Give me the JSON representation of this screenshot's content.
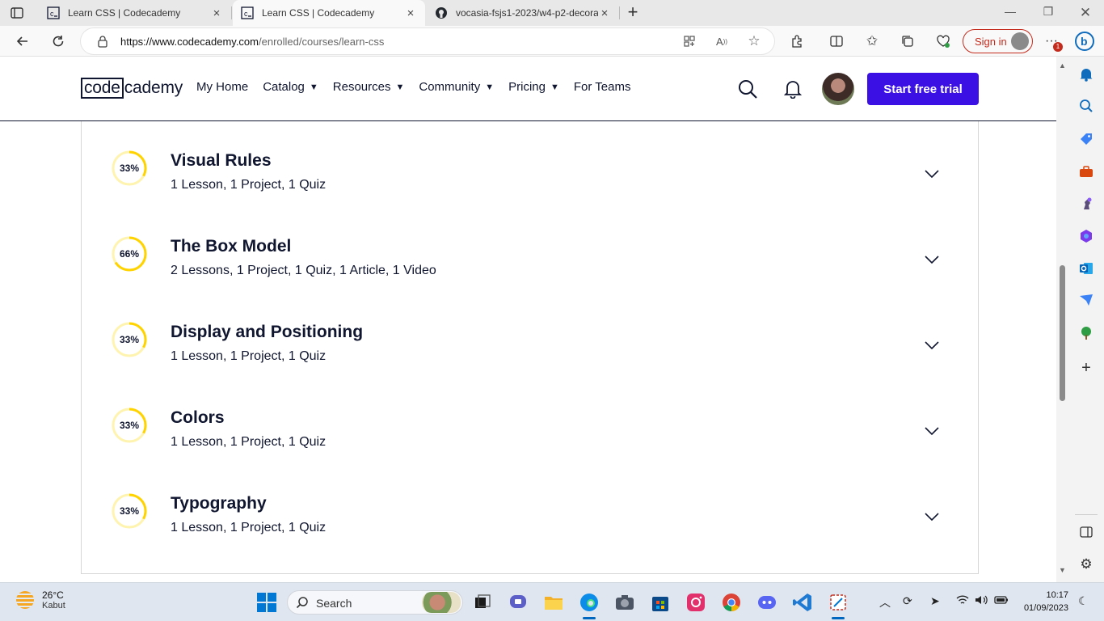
{
  "browser": {
    "tabs": [
      {
        "title": "Learn CSS | Codecademy",
        "favicon": "codecademy-favicon",
        "active": false
      },
      {
        "title": "Learn CSS | Codecademy",
        "favicon": "codecademy-favicon",
        "active": true
      },
      {
        "title": "vocasia-fsjs1-2023/w4-p2-decora",
        "favicon": "github-favicon",
        "active": false
      }
    ],
    "url_host": "https://www.codecademy.com",
    "url_path": "/enrolled/courses/learn-css",
    "signin_label": "Sign in",
    "notification_badge": "1"
  },
  "header": {
    "logo_box": "code",
    "logo_rest": "cademy",
    "nav": [
      {
        "label": "My Home",
        "dropdown": false
      },
      {
        "label": "Catalog",
        "dropdown": true
      },
      {
        "label": "Resources",
        "dropdown": true
      },
      {
        "label": "Community",
        "dropdown": true
      },
      {
        "label": "Pricing",
        "dropdown": true
      },
      {
        "label": "For Teams",
        "dropdown": false
      }
    ],
    "caret": "▼",
    "cta_label": "Start free trial"
  },
  "modules": [
    {
      "title": "Visual Rules",
      "subtitle": "1 Lesson, 1 Project, 1 Quiz",
      "progress_label": "33%",
      "progress": 0.33
    },
    {
      "title": "The Box Model",
      "subtitle": "2 Lessons, 1 Project, 1 Quiz, 1 Article, 1 Video",
      "progress_label": "66%",
      "progress": 0.66
    },
    {
      "title": "Display and Positioning",
      "subtitle": "1 Lesson, 1 Project, 1 Quiz",
      "progress_label": "33%",
      "progress": 0.33
    },
    {
      "title": "Colors",
      "subtitle": "1 Lesson, 1 Project, 1 Quiz",
      "progress_label": "33%",
      "progress": 0.33
    },
    {
      "title": "Typography",
      "subtitle": "1 Lesson, 1 Project, 1 Quiz",
      "progress_label": "33%",
      "progress": 0.33
    }
  ],
  "colors": {
    "progress_fill": "#ffd300",
    "progress_track": "#fff3b0",
    "cta": "#3a10e5",
    "text": "#10162f"
  },
  "taskbar": {
    "weather_temp": "26°C",
    "weather_desc": "Kabut",
    "search_label": "Search",
    "time": "10:17",
    "date": "01/09/2023"
  }
}
